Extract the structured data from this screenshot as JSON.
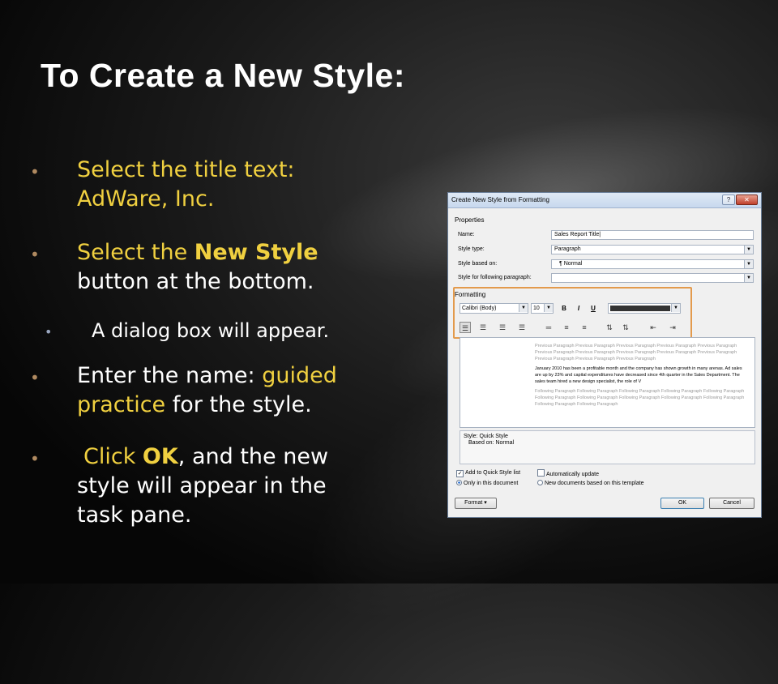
{
  "slide": {
    "title": "To Create a New Style:",
    "bullets": [
      {
        "l1": "Select the title text:",
        "l2": "AdWare, Inc."
      },
      {
        "a": "Select the ",
        "b": "New Style",
        "l2": "button at the bottom."
      },
      {
        "sub": "A dialog box will appear."
      },
      {
        "a": "Enter the name: ",
        "b": "guided",
        "c": "practice",
        "d": " for the style."
      },
      {
        "a": "Click ",
        "b": "OK",
        "c": ", and the new",
        "l2": "style will appear in the",
        "l3": "task pane."
      }
    ]
  },
  "dialog": {
    "title": "Create New Style from Formatting",
    "help": "?",
    "close": "✕",
    "properties_label": "Properties",
    "name_label": "Name:",
    "name_value": "Sales Report Title",
    "style_type_label": "Style type:",
    "style_type_value": "Paragraph",
    "based_on_label": "Style based on:",
    "based_on_value": "¶  Normal",
    "following_label": "Style for following paragraph:",
    "following_value": "",
    "formatting_label": "Formatting",
    "font": "Calibri (Body)",
    "size": "10",
    "bold": "B",
    "italic": "I",
    "underline": "U",
    "preview_prev": "Previous Paragraph Previous Paragraph Previous Paragraph Previous Paragraph Previous Paragraph Previous Paragraph Previous Paragraph Previous Paragraph Previous Paragraph Previous Paragraph Previous Paragraph Previous Paragraph Previous Paragraph",
    "preview_main": "January 2010 has been a profitable month and the company has shown growth in many arenas. Ad sales are up by 23% and capital expenditures have decreased since 4th quarter in the Sales Department. The sales team hired a new design specialist, the role of V",
    "preview_next": "Following Paragraph Following Paragraph Following Paragraph Following Paragraph Following Paragraph Following Paragraph Following Paragraph Following Paragraph Following Paragraph Following Paragraph Following Paragraph Following Paragraph",
    "desc_line1": "Style: Quick Style",
    "desc_line2": "Based on: Normal",
    "add_quick": "Add to Quick Style list",
    "auto_update": "Automatically update",
    "only_doc": "Only in this document",
    "new_docs": "New documents based on this template",
    "format_btn": "Format ▾",
    "ok_btn": "OK",
    "cancel_btn": "Cancel"
  }
}
